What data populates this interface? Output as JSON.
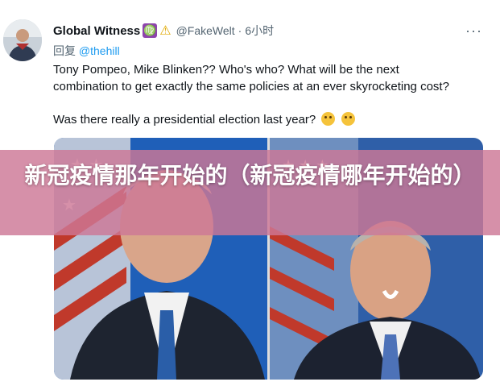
{
  "tweet": {
    "display_name": "Global Witness",
    "badges": [
      {
        "icon": "virgo-zodiac-icon",
        "glyph": "♍"
      },
      {
        "icon": "warning-icon",
        "glyph": "⚠"
      }
    ],
    "handle": "@FakeWelt",
    "separator": "·",
    "time": "6小时",
    "reply_prefix": "回复",
    "reply_mention": "@thehill",
    "text_line1": "Tony Pompeo, Mike Blinken??  Who's who? What will be the next",
    "text_line2": "combination to get exactly the same policies at an ever skyrocketing cost?",
    "text_line3": "Was there really a presidential election last year?",
    "text_emojis": [
      "thinking-face-icon",
      "rolling-eyes-face-icon"
    ],
    "more_icon": "more-options-icon",
    "more_glyph": "···"
  },
  "media": {
    "left_photo": "man-in-suit-left-photo",
    "right_photo": "man-in-suit-right-photo"
  },
  "overlay": {
    "headline": "新冠疫情那年开始的（新冠疫情哪年开始的）"
  },
  "colors": {
    "overlay": "#cd7896",
    "link": "#1d9bf0",
    "muted": "#536471"
  }
}
